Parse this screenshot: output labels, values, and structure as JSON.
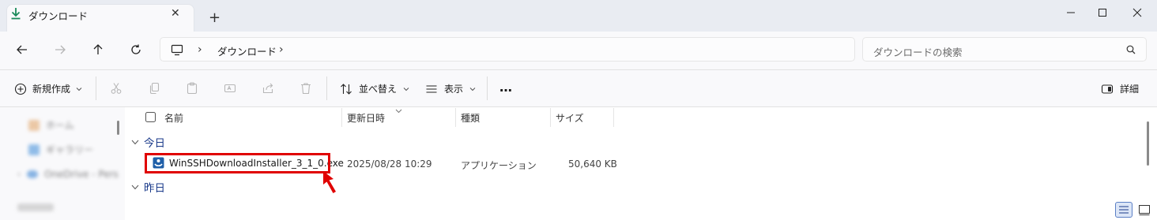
{
  "tab": {
    "title": "ダウンロード",
    "close": "✕",
    "new": "+"
  },
  "address": {
    "location": "ダウンロード",
    "separator": "›"
  },
  "search": {
    "placeholder": "ダウンロードの検索"
  },
  "commands": {
    "new": "新規作成",
    "sort": "並べ替え",
    "view": "表示",
    "more": "…",
    "details": "詳細"
  },
  "sidebar": {
    "items": [
      "ホーム",
      "ギャラリー",
      "OneDrive - Pers"
    ]
  },
  "columns": {
    "name": "名前",
    "date": "更新日時",
    "type": "種類",
    "size": "サイズ"
  },
  "groups": {
    "today": "今日",
    "yesterday": "昨日"
  },
  "file": {
    "name": "WinSSHDownloadInstaller_3_1_0.exe",
    "date": "2025/08/28 10:29",
    "type": "アプリケーション",
    "size": "50,640 KB"
  },
  "colors": {
    "highlight": "#e00000",
    "accent": "#1a3a8a"
  }
}
